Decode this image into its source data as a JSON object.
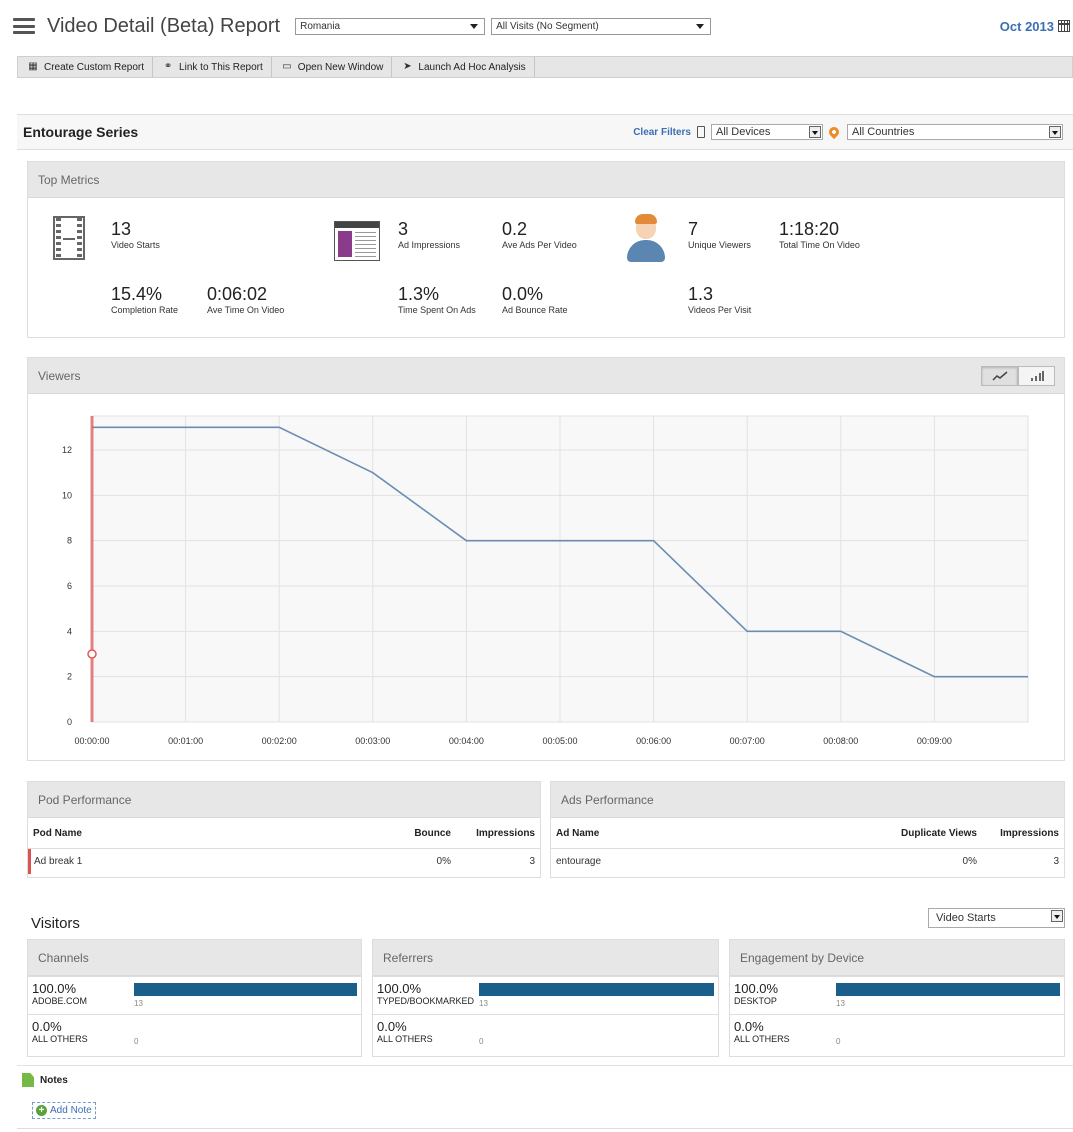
{
  "header": {
    "title": "Video Detail (Beta) Report",
    "country_select": "Romania",
    "segment_select": "All Visits (No Segment)",
    "date": "Oct 2013"
  },
  "toolbar": {
    "create_custom_report": "Create Custom Report",
    "link_report": "Link to This Report",
    "open_new_window": "Open New Window",
    "launch_ad_hoc": "Launch Ad Hoc Analysis"
  },
  "series": {
    "title": "Entourage Series",
    "clear_filters": "Clear Filters",
    "devices_select": "All Devices",
    "countries_select": "All Countries"
  },
  "top_metrics": {
    "title": "Top Metrics",
    "video_starts": {
      "value": "13",
      "label": "Video Starts"
    },
    "completion_rate": {
      "value": "15.4%",
      "label": "Completion Rate"
    },
    "ave_time_on_video": {
      "value": "0:06:02",
      "label": "Ave Time On Video"
    },
    "ad_impressions": {
      "value": "3",
      "label": "Ad Impressions"
    },
    "ave_ads_per_video": {
      "value": "0.2",
      "label": "Ave Ads Per Video"
    },
    "time_spent_on_ads": {
      "value": "1.3%",
      "label": "Time Spent On Ads"
    },
    "ad_bounce_rate": {
      "value": "0.0%",
      "label": "Ad Bounce Rate"
    },
    "unique_viewers": {
      "value": "7",
      "label": "Unique Viewers"
    },
    "total_time_on_video": {
      "value": "1:18:20",
      "label": "Total Time On Video"
    },
    "videos_per_visit": {
      "value": "1.3",
      "label": "Videos Per Visit"
    }
  },
  "viewers": {
    "title": "Viewers"
  },
  "chart_data": {
    "type": "line",
    "title": "",
    "xlabel": "",
    "ylabel": "",
    "x_ticks": [
      "00:00:00",
      "00:01:00",
      "00:02:00",
      "00:03:00",
      "00:04:00",
      "00:05:00",
      "00:06:00",
      "00:07:00",
      "00:08:00",
      "00:09:00"
    ],
    "y_ticks": [
      0,
      2,
      4,
      6,
      8,
      10,
      12
    ],
    "ylim": [
      0,
      13.5
    ],
    "xlim_minutes": [
      0,
      10
    ],
    "grid": true,
    "series": [
      {
        "color": "#6a8db2",
        "points": [
          {
            "x_min": 0,
            "y": 13
          },
          {
            "x_min": 2,
            "y": 13
          },
          {
            "x_min": 3,
            "y": 11
          },
          {
            "x_min": 4,
            "y": 8
          },
          {
            "x_min": 6,
            "y": 8
          },
          {
            "x_min": 7,
            "y": 4
          },
          {
            "x_min": 8,
            "y": 4
          },
          {
            "x_min": 9,
            "y": 2
          },
          {
            "x_min": 10,
            "y": 2
          }
        ]
      }
    ],
    "ad_marker": {
      "x_min": 0,
      "y": 3,
      "color": "#e05a5a"
    }
  },
  "pod_performance": {
    "title": "Pod Performance",
    "columns": [
      "Pod Name",
      "Bounce",
      "Impressions"
    ],
    "rows": [
      [
        "Ad break 1",
        "0%",
        "3"
      ]
    ]
  },
  "ads_performance": {
    "title": "Ads Performance",
    "columns": [
      "Ad Name",
      "Duplicate Views",
      "Impressions"
    ],
    "rows": [
      [
        "entourage",
        "0%",
        "3"
      ]
    ]
  },
  "visitors": {
    "title": "Visitors",
    "metric_select": "Video Starts",
    "bar_color": "#1a5e8a",
    "channels": {
      "title": "Channels",
      "rows": [
        {
          "pct": "100.0%",
          "name": "ADOBE.COM",
          "count": "13",
          "fraction": 1.0
        },
        {
          "pct": "0.0%",
          "name": "ALL OTHERS",
          "count": "0",
          "fraction": 0
        }
      ]
    },
    "referrers": {
      "title": "Referrers",
      "rows": [
        {
          "pct": "100.0%",
          "name": "TYPED/BOOKMARKED",
          "count": "13",
          "fraction": 1.0
        },
        {
          "pct": "0.0%",
          "name": "ALL OTHERS",
          "count": "0",
          "fraction": 0
        }
      ]
    },
    "devices": {
      "title": "Engagement by Device",
      "rows": [
        {
          "pct": "100.0%",
          "name": "DESKTOP",
          "count": "13",
          "fraction": 1.0
        },
        {
          "pct": "0.0%",
          "name": "ALL OTHERS",
          "count": "0",
          "fraction": 0
        }
      ]
    }
  },
  "notes": {
    "title": "Notes",
    "add_note": "Add Note"
  }
}
